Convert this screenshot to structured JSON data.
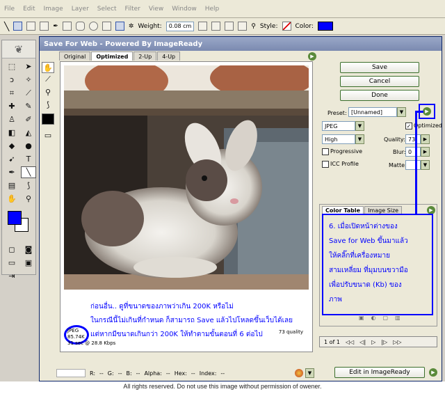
{
  "menu": [
    "File",
    "Edit",
    "Image",
    "Layer",
    "Select",
    "Filter",
    "View",
    "Window",
    "Help"
  ],
  "options": {
    "weight_label": "Weight:",
    "weight_value": "0.08 cm",
    "style_label": "Style:",
    "color_label": "Color:",
    "color_value": "#0000ff"
  },
  "dialog": {
    "title": "Save For Web - Powered By ImageReady",
    "tabs": [
      "Original",
      "Optimized",
      "2-Up",
      "4-Up"
    ],
    "active_tab": "Optimized",
    "buttons": {
      "save": "Save",
      "cancel": "Cancel",
      "done": "Done",
      "edit": "Edit in ImageReady"
    },
    "settings": {
      "preset_label": "Preset:",
      "preset_value": "[Unnamed]",
      "format": "JPEG",
      "quality_level": "High",
      "optimized_label": "Optimized",
      "quality_label": "Quality:",
      "quality_value": "73",
      "progressive_label": "Progressive",
      "blur_label": "Blur:",
      "blur_value": "0",
      "icc_label": "ICC Profile",
      "matte_label": "Matte:"
    },
    "panel_tabs": [
      "Color Table",
      "Image Size"
    ],
    "image_info": {
      "format": "JPEG",
      "size": "85.74K",
      "time": "31 sec @ 28.8 Kbps",
      "quality": "73 quality"
    },
    "nav": {
      "page": "1 of 1"
    },
    "status": {
      "r": "R:",
      "g": "G:",
      "b": "B:",
      "alpha": "Alpha:",
      "hex": "Hex:",
      "index": "Index:"
    }
  },
  "annotations": {
    "left": [
      "ก่อนอื่น.. ดูที่ขนาดของภาพว่าเกิน 200K หรือไม่",
      "ในกรณีนี้ไม่เกินที่กำหนด ก็สามารถ Save แล้วไปโหลดขึ้นเว็บได้เลย",
      "แต่หากมีขนาดเกินกว่า 200K ให้ทำตามขั้นตอนที่ 6 ต่อไป"
    ],
    "right": [
      "6. เมื่อเปิดหน้าต่างของ",
      "Save for Web ขึ้นมาแล้ว",
      "ให้คลิ๊กที่เครื่องหมาย",
      "สามเหลี่ยม ที่มุมบนขวามือ",
      "เพื่อปรับขนาด (Kb) ของ",
      "ภาพ"
    ]
  },
  "footer": "All rights reserved. Do not use this image without permission of owener."
}
